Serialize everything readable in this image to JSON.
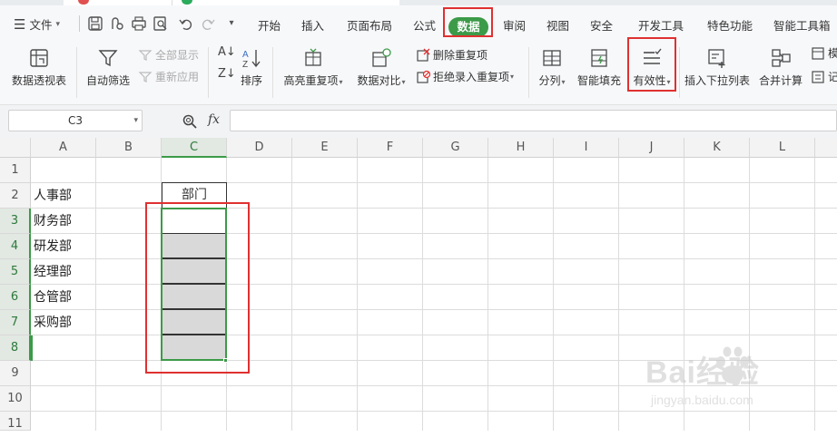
{
  "menubar": {
    "file_menu": "文件",
    "tabs": [
      "开始",
      "插入",
      "页面布局",
      "公式",
      "数据",
      "审阅",
      "视图",
      "安全",
      "开发工具",
      "特色功能",
      "智能工具箱"
    ],
    "active_tab": "数据"
  },
  "ribbon": {
    "pivot_table": "数据透视表",
    "auto_filter": "自动筛选",
    "show_all": "全部显示",
    "reapply": "重新应用",
    "sort": "排序",
    "highlight_dup": "高亮重复项",
    "data_compare": "数据对比",
    "remove_dup": "删除重复项",
    "reject_dup": "拒绝录入重复项",
    "split_col": "分列",
    "flash_fill": "智能填充",
    "validity": "有效性",
    "insert_dropdown": "插入下拉列表",
    "consolidate": "合并计算",
    "partial_label": "记",
    "partial_label_top": "模"
  },
  "formula_bar": {
    "name_box": "C3",
    "fx_label": "fx",
    "formula": ""
  },
  "sheet": {
    "columns": [
      "A",
      "B",
      "C",
      "D",
      "E",
      "F",
      "G",
      "H",
      "I",
      "J",
      "K",
      "L"
    ],
    "rows": [
      "1",
      "2",
      "3",
      "4",
      "5",
      "6",
      "7",
      "8",
      "9",
      "10",
      "11"
    ],
    "selected_column": "C",
    "cells": {
      "A2": "人事部",
      "A3": "财务部",
      "A4": "研发部",
      "A5": "经理部",
      "A6": "仓管部",
      "A7": "采购部",
      "C2": "部门"
    }
  },
  "watermark": {
    "logo_text": "Bai经验",
    "url": "jingyan.baidu.com"
  },
  "colors": {
    "accent_green": "#3c9a48",
    "annotation_red": "#e03030",
    "selected_fill": "#d9d9d9"
  }
}
